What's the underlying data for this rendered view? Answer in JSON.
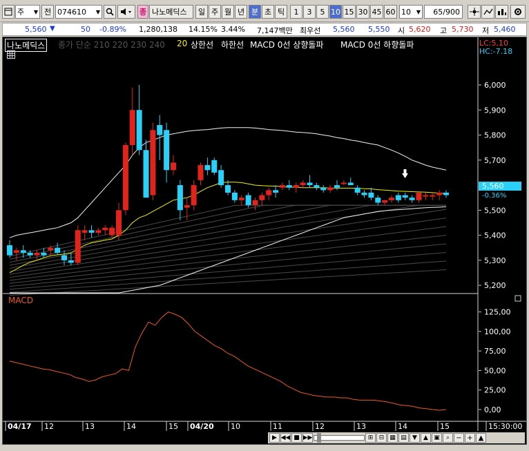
{
  "toolbar": {
    "market": "주",
    "period_type": "전",
    "stock_code": "074610",
    "stock_name": "나노메딕스",
    "stock_badge": "종",
    "tabs": [
      "일",
      "주",
      "월",
      "년",
      "분",
      "초",
      "틱"
    ],
    "active_tab": "분",
    "intervals": [
      "1",
      "3",
      "5",
      "10",
      "15",
      "30",
      "45",
      "60"
    ],
    "active_interval": "10",
    "interval_select": "10",
    "page_count": "65/900"
  },
  "quote": {
    "price": "5,560",
    "change": "50",
    "change_pct": "-0.89%",
    "volume": "1,280,138",
    "turnover_pct": "14.15%",
    "pct2": "3.44%",
    "amount": "7,147백만",
    "best_label": "최우선",
    "bid1": "5,560",
    "bid2": "5,550",
    "open_label": "시",
    "open": "5,620",
    "high_label": "고",
    "high": "5,730",
    "low_label": "저",
    "low": "5,460"
  },
  "legend": {
    "name": "나노메딕스",
    "ma_items": "종가 단순 210  220  230  240",
    "ma20": "20",
    "band_upper": "상한선",
    "band_lower": "하한선",
    "macd_up": "MACD 0선 상향돌파",
    "macd_down": "MACD 0선 하향돌파",
    "lc": "LC:5,10",
    "hc": "HC:-7.18",
    "price_tag": "5,560",
    "price_tag_pct": "-0.36%"
  },
  "price_axis": [
    "6,000",
    "5,900",
    "5,800",
    "5,700",
    "5,600",
    "5,500",
    "5,400",
    "5,300",
    "5,200"
  ],
  "macd_axis": [
    "125,00",
    "100,00",
    "75,00",
    "50,00",
    "25,00",
    "0,00"
  ],
  "macd_title": "MACD",
  "time_axis": [
    {
      "t": "04/17",
      "bold": true
    },
    {
      "t": "12"
    },
    {
      "t": "13"
    },
    {
      "t": "14"
    },
    {
      "t": "15"
    },
    {
      "t": "04/20",
      "bold": true
    },
    {
      "t": "10"
    },
    {
      "t": "11"
    },
    {
      "t": "12"
    },
    {
      "t": "13"
    },
    {
      "t": "14"
    },
    {
      "t": "15"
    },
    {
      "t": "15:30:00"
    }
  ],
  "colors": {
    "up": "#e0241c",
    "down": "#2ad0f7",
    "ma": "#f2f200",
    "band": "#f4f4f4",
    "macd": "#f25a16"
  },
  "chart_data": {
    "type": "candlestick",
    "ylim": [
      5170,
      6080
    ],
    "candles": [
      [
        5360,
        5380,
        5310,
        5320
      ],
      [
        5330,
        5350,
        5300,
        5340
      ],
      [
        5340,
        5360,
        5310,
        5330
      ],
      [
        5330,
        5340,
        5310,
        5320
      ],
      [
        5320,
        5340,
        5300,
        5330
      ],
      [
        5330,
        5350,
        5310,
        5320
      ],
      [
        5340,
        5360,
        5320,
        5350
      ],
      [
        5350,
        5370,
        5320,
        5330
      ],
      [
        5320,
        5340,
        5280,
        5300
      ],
      [
        5300,
        5330,
        5280,
        5290
      ],
      [
        5290,
        5440,
        5280,
        5420
      ],
      [
        5410,
        5440,
        5380,
        5420
      ],
      [
        5420,
        5440,
        5390,
        5410
      ],
      [
        5410,
        5430,
        5400,
        5420
      ],
      [
        5420,
        5440,
        5400,
        5430
      ],
      [
        5400,
        5440,
        5390,
        5430
      ],
      [
        5400,
        5530,
        5380,
        5500
      ],
      [
        5500,
        5770,
        5480,
        5760
      ],
      [
        5760,
        5990,
        5720,
        5900
      ],
      [
        5900,
        6000,
        5720,
        5740
      ],
      [
        5740,
        5780,
        5560,
        5550
      ],
      [
        5560,
        5850,
        5540,
        5820
      ],
      [
        5840,
        5880,
        5700,
        5800
      ],
      [
        5820,
        5850,
        5610,
        5660
      ],
      [
        5660,
        5720,
        5640,
        5690
      ],
      [
        5600,
        5620,
        5460,
        5500
      ],
      [
        5510,
        5550,
        5460,
        5520
      ],
      [
        5520,
        5620,
        5500,
        5600
      ],
      [
        5620,
        5690,
        5600,
        5680
      ],
      [
        5680,
        5710,
        5640,
        5660
      ],
      [
        5700,
        5710,
        5640,
        5650
      ],
      [
        5660,
        5680,
        5590,
        5600
      ],
      [
        5600,
        5620,
        5560,
        5570
      ],
      [
        5570,
        5580,
        5530,
        5540
      ],
      [
        5540,
        5560,
        5520,
        5550
      ],
      [
        5560,
        5570,
        5510,
        5520
      ],
      [
        5520,
        5550,
        5500,
        5540
      ],
      [
        5540,
        5570,
        5520,
        5560
      ],
      [
        5560,
        5590,
        5540,
        5580
      ],
      [
        5580,
        5600,
        5550,
        5570
      ],
      [
        5590,
        5610,
        5580,
        5600
      ],
      [
        5600,
        5620,
        5580,
        5590
      ],
      [
        5590,
        5610,
        5570,
        5600
      ],
      [
        5600,
        5620,
        5590,
        5610
      ],
      [
        5610,
        5640,
        5590,
        5600
      ],
      [
        5600,
        5610,
        5580,
        5590
      ],
      [
        5590,
        5600,
        5570,
        5580
      ],
      [
        5580,
        5600,
        5570,
        5590
      ],
      [
        5600,
        5620,
        5580,
        5590
      ],
      [
        5610,
        5620,
        5600,
        5610
      ],
      [
        5610,
        5630,
        5600,
        5600
      ],
      [
        5590,
        5600,
        5560,
        5570
      ],
      [
        5570,
        5580,
        5550,
        5560
      ],
      [
        5570,
        5590,
        5540,
        5550
      ],
      [
        5550,
        5560,
        5520,
        5530
      ],
      [
        5530,
        5540,
        5520,
        5540
      ],
      [
        5540,
        5560,
        5530,
        5550
      ],
      [
        5560,
        5570,
        5530,
        5540
      ],
      [
        5560,
        5570,
        5540,
        5550
      ],
      [
        5550,
        5560,
        5530,
        5540
      ],
      [
        5540,
        5560,
        5530,
        5570
      ],
      [
        5560,
        5570,
        5540,
        5560
      ],
      [
        5560,
        5570,
        5540,
        5560
      ],
      [
        5560,
        5580,
        5540,
        5570
      ],
      [
        5570,
        5580,
        5550,
        5560
      ]
    ],
    "ma20": [
      5250,
      5265,
      5280,
      5292,
      5300,
      5310,
      5318,
      5322,
      5325,
      5330,
      5345,
      5360,
      5370,
      5375,
      5380,
      5385,
      5400,
      5420,
      5450,
      5470,
      5480,
      5495,
      5510,
      5525,
      5540,
      5545,
      5550,
      5560,
      5575,
      5590,
      5600,
      5610,
      5612,
      5612,
      5610,
      5605,
      5600,
      5598,
      5597,
      5596,
      5594,
      5592,
      5591,
      5590,
      5590,
      5590,
      5590,
      5589,
      5588,
      5588,
      5588,
      5587,
      5586,
      5585,
      5582,
      5580,
      5578,
      5576,
      5575,
      5574,
      5573,
      5572,
      5570,
      5568,
      5566
    ],
    "band_upper": [
      5390,
      5400,
      5405,
      5410,
      5415,
      5420,
      5425,
      5430,
      5440,
      5450,
      5470,
      5500,
      5530,
      5560,
      5590,
      5620,
      5650,
      5680,
      5720,
      5750,
      5770,
      5780,
      5790,
      5800,
      5805,
      5810,
      5815,
      5818,
      5820,
      5822,
      5825,
      5828,
      5830,
      5830,
      5830,
      5830,
      5828,
      5825,
      5822,
      5820,
      5818,
      5815,
      5812,
      5810,
      5808,
      5805,
      5800,
      5796,
      5790,
      5786,
      5780,
      5776,
      5770,
      5765,
      5760,
      5750,
      5740,
      5728,
      5715,
      5700,
      5690,
      5680,
      5672,
      5666,
      5660
    ],
    "band_lower": [
      5090,
      5095,
      5100,
      5105,
      5110,
      5115,
      5120,
      5125,
      5130,
      5135,
      5140,
      5145,
      5150,
      5155,
      5160,
      5165,
      5170,
      5175,
      5180,
      5185,
      5190,
      5195,
      5200,
      5210,
      5220,
      5230,
      5240,
      5250,
      5260,
      5270,
      5280,
      5290,
      5300,
      5310,
      5320,
      5330,
      5340,
      5350,
      5360,
      5370,
      5380,
      5390,
      5400,
      5410,
      5420,
      5430,
      5440,
      5450,
      5460,
      5470,
      5475,
      5480,
      5485,
      5490,
      5495,
      5498,
      5500,
      5502,
      5504,
      5506,
      5508,
      5510,
      5511,
      5512,
      5514
    ],
    "macd": [
      62,
      60,
      58,
      56,
      54,
      52,
      51,
      49,
      47,
      45,
      41,
      39,
      36,
      38,
      42,
      44,
      46,
      52,
      50,
      80,
      98,
      112,
      108,
      118,
      125,
      122,
      118,
      110,
      100,
      94,
      88,
      82,
      78,
      72,
      68,
      62,
      56,
      52,
      48,
      44,
      40,
      36,
      30,
      26,
      22,
      20,
      18,
      17,
      16,
      16,
      15,
      15,
      13,
      12,
      12,
      12,
      11,
      10,
      8,
      6,
      5,
      4,
      2,
      1,
      0,
      -1,
      0
    ]
  }
}
